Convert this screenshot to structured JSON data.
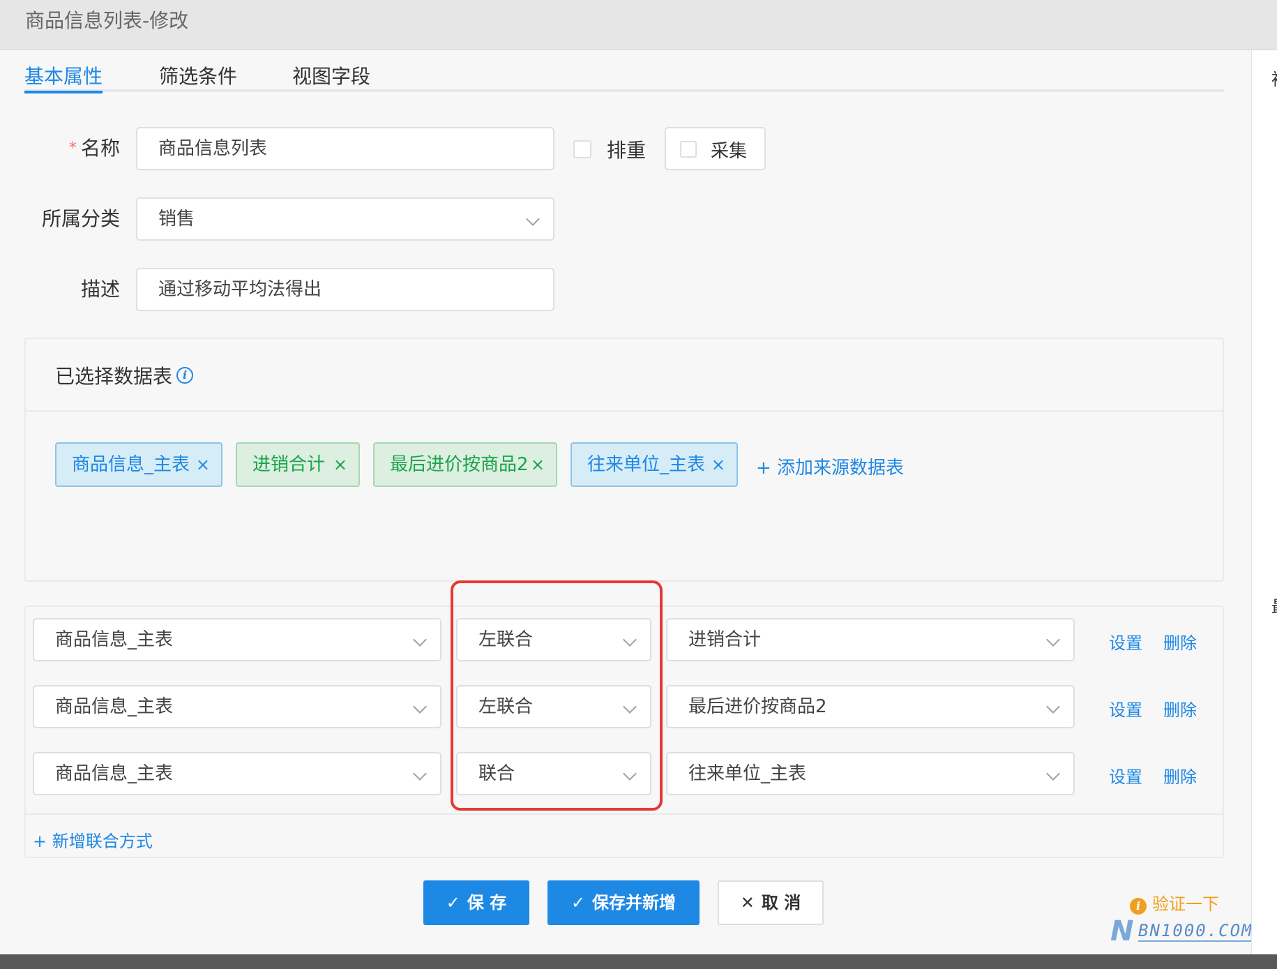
{
  "dialog": {
    "title": "商品信息列表-修改"
  },
  "tabs": [
    {
      "label": "基本属性",
      "active": true
    },
    {
      "label": "筛选条件",
      "active": false
    },
    {
      "label": "视图字段",
      "active": false
    }
  ],
  "form": {
    "name": {
      "label": "名称",
      "required_mark": "*",
      "value": "商品信息列表"
    },
    "dedupe": {
      "label": "排重",
      "checked": false
    },
    "collect": {
      "label": "采集",
      "checked": false
    },
    "category": {
      "label": "所属分类",
      "value": "销售"
    },
    "description": {
      "label": "描述",
      "value": "通过移动平均法得出"
    }
  },
  "selected_tables": {
    "title": "已选择数据表",
    "info_icon": "i",
    "chips": [
      {
        "label": "商品信息_主表",
        "close": "×",
        "color": "blue"
      },
      {
        "label": "进销合计",
        "close": "×",
        "color": "green"
      },
      {
        "label": "最后进价按商品2",
        "close": "×",
        "color": "green"
      },
      {
        "label": "往来单位_主表",
        "close": "×",
        "color": "blue"
      }
    ],
    "add_link": "+ 添加来源数据表"
  },
  "joins": {
    "rows": [
      {
        "left": "商品信息_主表",
        "type": "左联合",
        "right": "进销合计",
        "set": "设置",
        "delete": "删除"
      },
      {
        "left": "商品信息_主表",
        "type": "左联合",
        "right": "最后进价按商品2",
        "set": "设置",
        "delete": "删除"
      },
      {
        "left": "商品信息_主表",
        "type": "联合",
        "right": "往来单位_主表",
        "set": "设置",
        "delete": "删除"
      }
    ],
    "add_link": "+ 新增联合方式"
  },
  "buttons": {
    "save": "保 存",
    "save_and_new": "保存并新增",
    "cancel": "取 消",
    "check_icon": "✓",
    "cancel_icon": "✕"
  },
  "verify": {
    "icon": "i",
    "label": "验证一下"
  },
  "watermark": {
    "logo": "N",
    "text": "BN1000.COM"
  },
  "right_strip": {
    "top_char": "袖",
    "mid_char": "最"
  },
  "colors": {
    "primary": "#1e88e5",
    "chip_blue": "#d6ecf6",
    "chip_green": "#dcefe0",
    "highlight_red": "#e53935",
    "warning": "#f0a020"
  }
}
